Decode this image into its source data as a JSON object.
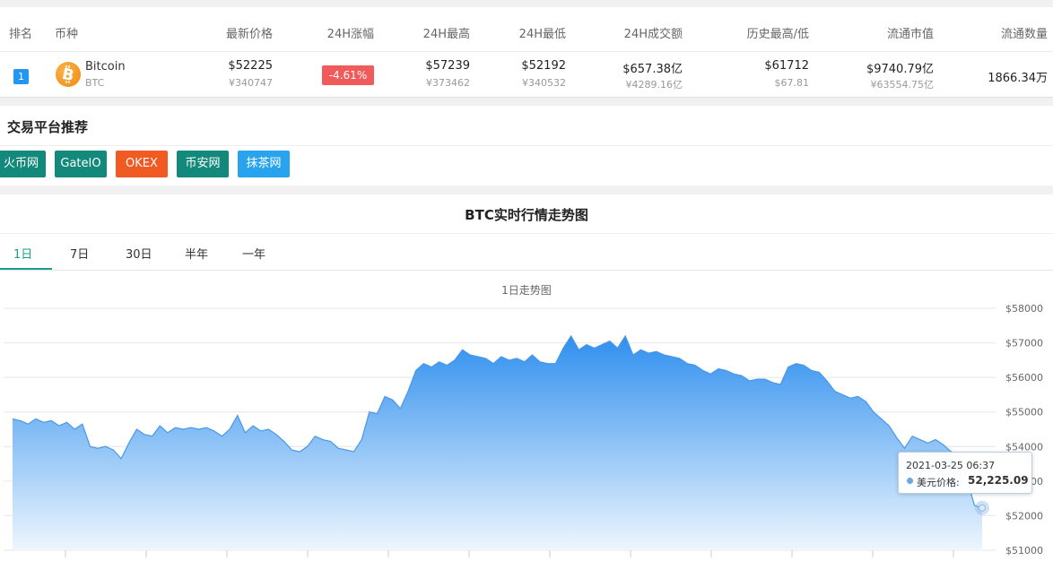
{
  "table": {
    "headers": {
      "rank": "排名",
      "coin": "币种",
      "price": "最新价格",
      "change": "24H涨幅",
      "high": "24H最高",
      "low": "24H最低",
      "volume": "24H成交额",
      "ath_atl": "历史最高/低",
      "market_cap": "流通市值",
      "supply": "流通数量"
    },
    "row": {
      "rank": "1",
      "name": "Bitcoin",
      "symbol": "BTC",
      "price_usd": "$52225",
      "price_cny": "¥340747",
      "change": "-4.61%",
      "high_usd": "$57239",
      "high_cny": "¥373462",
      "low_usd": "$52192",
      "low_cny": "¥340532",
      "volume_usd": "$657.38亿",
      "volume_cny": "¥4289.16亿",
      "ath": "$61712",
      "atl": "$67.81",
      "mcap_usd": "$9740.79亿",
      "mcap_cny": "¥63554.75亿",
      "supply": "1866.34万"
    }
  },
  "exchanges": {
    "title": "交易平台推荐",
    "items": [
      {
        "label": "火币网",
        "color": "#13897c"
      },
      {
        "label": "GateIO",
        "color": "#13897c"
      },
      {
        "label": "OKEX",
        "color": "#f25a24"
      },
      {
        "label": "币安网",
        "color": "#13897c"
      },
      {
        "label": "抹茶网",
        "color": "#2aa3ef"
      }
    ]
  },
  "chart_section": {
    "title": "BTC实时行情走势图",
    "tabs": [
      "1日",
      "7日",
      "30日",
      "半年",
      "一年"
    ],
    "active_tab": "1日"
  },
  "chart_data": {
    "type": "area",
    "title": "1日走势图",
    "y_ticks": [
      "$58000",
      "$57000",
      "$56000",
      "$55000",
      "$54000",
      "$53000",
      "$52000",
      "$51000"
    ],
    "ylim": [
      51000,
      58000
    ],
    "grid": true,
    "series": [
      {
        "values": [
          54800,
          54750,
          54650,
          54800,
          54700,
          54750,
          54600,
          54700,
          54500,
          54650,
          54000,
          53950,
          54000,
          53900,
          53650,
          54100,
          54500,
          54350,
          54300,
          54600,
          54400,
          54550,
          54500,
          54550,
          54500,
          54550,
          54450,
          54300,
          54500,
          54900,
          54400,
          54600,
          54450,
          54500,
          54350,
          54150,
          53900,
          53850,
          54000,
          54300,
          54200,
          54150,
          53950,
          53900,
          53850,
          54200,
          55000,
          54950,
          55450,
          55350,
          55100,
          55600,
          56200,
          56400,
          56300,
          56450,
          56350,
          56500,
          56800,
          56650,
          56600,
          56550,
          56400,
          56600,
          56500,
          56550,
          56450,
          56650,
          56450,
          56400,
          56400,
          56850,
          57200,
          56800,
          56950,
          56850,
          56950,
          57050,
          56850,
          57200,
          56650,
          56800,
          56700,
          56750,
          56650,
          56600,
          56550,
          56400,
          56350,
          56200,
          56100,
          56250,
          56200,
          56100,
          56050,
          55900,
          55950,
          55950,
          55850,
          55800,
          56300,
          56400,
          56350,
          56200,
          56150,
          55900,
          55600,
          55500,
          55400,
          55450,
          55300,
          55000,
          54800,
          54600,
          54250,
          53950,
          54300,
          54200,
          54100,
          54200,
          54050,
          53850,
          53800,
          53100,
          52300,
          52225
        ]
      }
    ],
    "tooltip": {
      "date": "2021-03-25 06:37",
      "label": "美元价格:",
      "value": "52,225.09"
    }
  },
  "colors": {
    "area_top": "#2f8fee",
    "area_bottom": "#eef6fe",
    "line": "#4a97e8",
    "accent": "#1a9e8f"
  }
}
